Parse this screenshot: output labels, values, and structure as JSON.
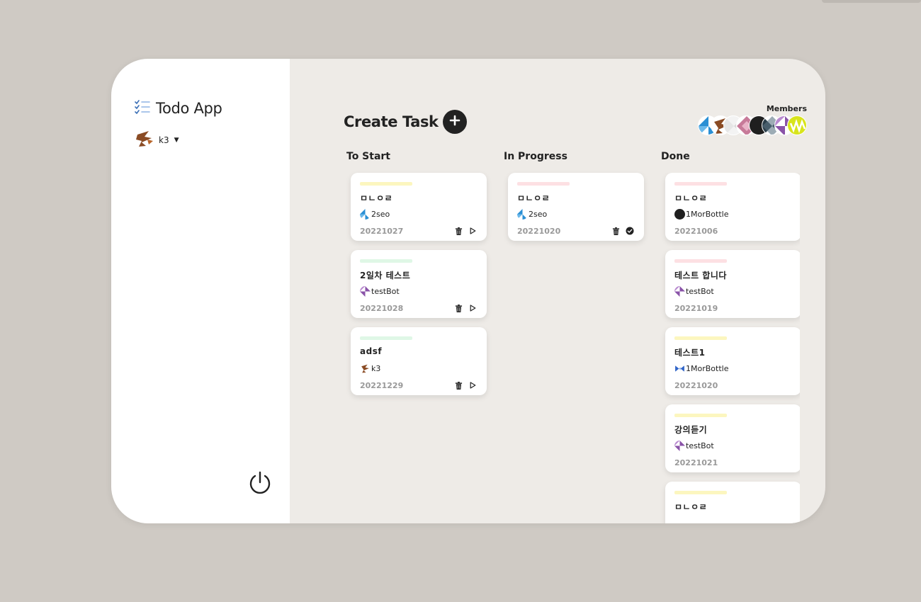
{
  "app": {
    "title": "Todo App"
  },
  "user": {
    "name": "k3"
  },
  "header": {
    "title": "Create Task"
  },
  "members": {
    "label": "Members",
    "count": 8
  },
  "colors": {
    "yellow": "#fcf6bf",
    "pink": "#fde0e3",
    "green": "#dff7e6",
    "dark": "#222222"
  },
  "columns": [
    {
      "title": "To Start",
      "cards": [
        {
          "title": "ㅁㄴㅇㄹ",
          "assignee": "2seo",
          "date": "20221027",
          "tag": "yellow"
        },
        {
          "title": "2일차 테스트",
          "assignee": "testBot",
          "date": "20221028",
          "tag": "green"
        },
        {
          "title": "adsf",
          "assignee": "k3",
          "date": "20221229",
          "tag": "green"
        }
      ]
    },
    {
      "title": "In Progress",
      "cards": [
        {
          "title": "ㅁㄴㅇㄹ",
          "assignee": "2seo",
          "date": "20221020",
          "tag": "pink"
        }
      ]
    },
    {
      "title": "Done",
      "cards": [
        {
          "title": "ㅁㄴㅇㄹ",
          "assignee": "1MorBottle",
          "date": "20221006",
          "tag": "pink"
        },
        {
          "title": "테스트 합니다",
          "assignee": "testBot",
          "date": "20221019",
          "tag": "pink"
        },
        {
          "title": "테스트1",
          "assignee": "1MorBottle",
          "date": "20221020",
          "tag": "yellow"
        },
        {
          "title": "강의듣기",
          "assignee": "testBot",
          "date": "20221021",
          "tag": "yellow"
        },
        {
          "title": "ㅁㄴㅇㄹ",
          "assignee": "",
          "date": "",
          "tag": "yellow"
        }
      ]
    }
  ],
  "icons": {
    "brand": "checklist-icon",
    "add": "plus-icon",
    "logout": "power-icon",
    "delete": "trash-icon",
    "start": "play-icon",
    "complete": "check-circle-icon"
  }
}
